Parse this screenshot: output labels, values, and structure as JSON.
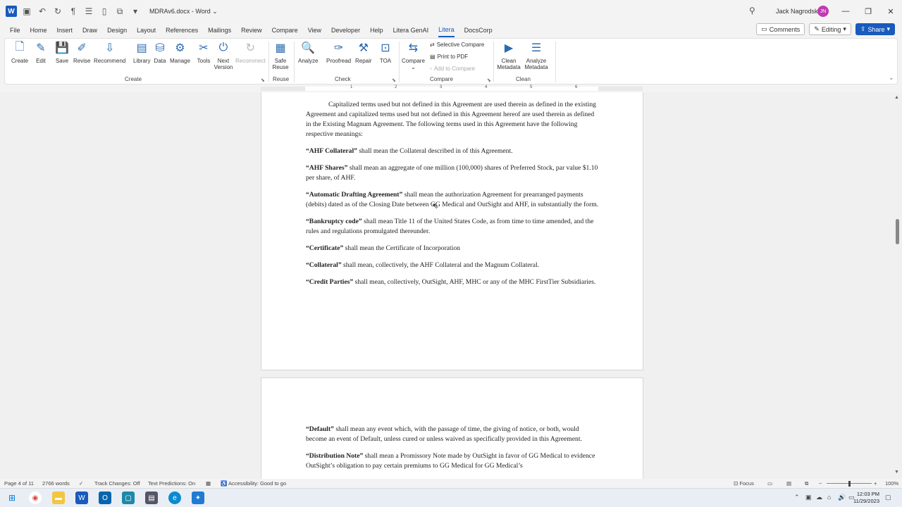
{
  "window": {
    "doc_title": "MDRAv6.docx",
    "app_name": "Word",
    "user_name": "Jack Nagrodski",
    "user_initials": "JN"
  },
  "menu": {
    "tabs": [
      "File",
      "Home",
      "Insert",
      "Draw",
      "Design",
      "Layout",
      "References",
      "Mailings",
      "Review",
      "Compare",
      "View",
      "Developer",
      "Help",
      "Litera GenAI",
      "Litera",
      "DocsCorp"
    ],
    "active_tab": "Litera",
    "comments_label": "Comments",
    "editing_label": "Editing",
    "share_label": "Share"
  },
  "ribbon": {
    "create": {
      "label": "Create",
      "buttons": [
        "Create",
        "Edit",
        "Save",
        "Revise",
        "Recommend",
        "Library",
        "Data",
        "Manage",
        "Tools",
        "Next Version",
        "Recommect"
      ]
    },
    "reuse": {
      "label": "Reuse",
      "buttons": [
        "Safe Reuse"
      ]
    },
    "check": {
      "label": "Check",
      "buttons": [
        "Analyze",
        "Proofread",
        "Repair",
        "TOA"
      ]
    },
    "compare": {
      "label": "Compare",
      "big_button": "Compare",
      "items": [
        "Selective Compare",
        "Print to PDF",
        "Add to Compare"
      ]
    },
    "clean": {
      "label": "Clean",
      "buttons": [
        "Clean Metadata",
        "Analyze Metadata"
      ]
    }
  },
  "ruler": {
    "numbers": [
      "1",
      "2",
      "3",
      "4",
      "5",
      "6"
    ]
  },
  "document": {
    "intro": "Capitalized terms used but not defined in this Agreement are used therein as defined in the existing Agreement and capitalized terms used but not defined in this Agreement hereof are used therein as defined in the Existing Magnum Agreement.  The following terms used in this Agreement have the following respective meanings:",
    "defs": [
      {
        "term": "“AHF Collateral”",
        "text": " shall mean the Collateral described in of this Agreement."
      },
      {
        "term": " “AHF Shares”",
        "text": " shall mean an aggregate of one million (100,000) shares of Preferred Stock, par value $1.10 per share, of AHF."
      },
      {
        "term": "“Automatic Drafting Agreement”",
        "text": " shall mean the authorization Agreement for prearranged payments (debits) dated as of the Closing Date between GG Medical and OutSight and AHF, in substantially the form."
      },
      {
        "term": "“Bankruptcy code”",
        "text": " shall mean Title 11 of the United States Code, as from time to time amended, and the rules and regulations promulgated thereunder."
      },
      {
        "term": "“Certificate”",
        "text": " shall mean the Certificate of Incorporation"
      },
      {
        "term": "“Collateral”",
        "text": " shall mean, collectively, the AHF Collateral and the Magnum Collateral."
      },
      {
        "term": " “Credit Parties”",
        "text": " shall mean, collectively, OutSight, AHF, MHC or any of the  MHC FirstTier Subsidiaries."
      }
    ],
    "page2_defs": [
      {
        "term": "“Default”",
        "text": " shall mean any event which, with the passage of time, the giving of notice, or both, would become an event of Default, unless cured or unless waived as specifically provided in this Agreement."
      },
      {
        "term": "“Distribution Note”",
        "text": " shall mean a Promissory Note made by OutSight in favor of GG Medical to evidence OutSight’s obligation to pay certain premiums to GG Medical for GG Medical’s"
      }
    ]
  },
  "status": {
    "page": "Page 4 of 11",
    "words": "2766 words",
    "track_changes": "Track Changes: Off",
    "text_predictions": "Text Predictions: On",
    "accessibility": "Accessibility: Good to go",
    "focus": "Focus",
    "zoom": "100%"
  },
  "taskbar": {
    "time": "12:03 PM",
    "date": "11/29/2023"
  }
}
